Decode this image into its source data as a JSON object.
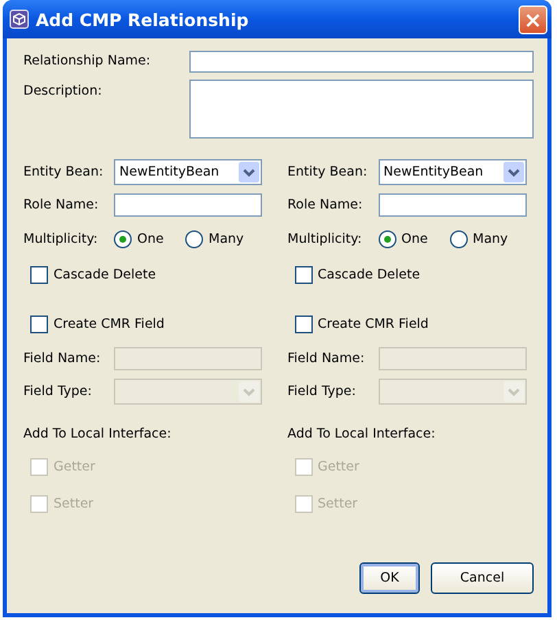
{
  "window": {
    "title": "Add CMP Relationship",
    "close": "×"
  },
  "relationship_name": {
    "label": "Relationship Name:"
  },
  "description": {
    "label": "Description:"
  },
  "roles": [
    {
      "entity_bean": {
        "label": "Entity Bean:",
        "value": "NewEntityBean"
      },
      "role_name": {
        "label": "Role Name:"
      },
      "multiplicity": {
        "label": "Multiplicity:",
        "options": [
          {
            "label": "One",
            "selected": true
          },
          {
            "label": "Many",
            "selected": false
          }
        ]
      },
      "cascade_delete": {
        "label": "Cascade Delete",
        "checked": false
      },
      "create_cmr_field": {
        "label": "Create CMR Field",
        "checked": false
      },
      "field_name": {
        "label": "Field Name:",
        "disabled": true
      },
      "field_type": {
        "label": "Field Type:",
        "disabled": true
      },
      "local_interface": {
        "label": "Add To Local Interface:",
        "options": [
          {
            "label": "Getter",
            "checked": false,
            "disabled": true
          },
          {
            "label": "Setter",
            "checked": false,
            "disabled": true
          }
        ]
      }
    },
    {
      "entity_bean": {
        "label": "Entity Bean:",
        "value": "NewEntityBean"
      },
      "role_name": {
        "label": "Role Name:"
      },
      "multiplicity": {
        "label": "Multiplicity:",
        "options": [
          {
            "label": "One",
            "selected": true
          },
          {
            "label": "Many",
            "selected": false
          }
        ]
      },
      "cascade_delete": {
        "label": "Cascade Delete",
        "checked": false
      },
      "create_cmr_field": {
        "label": "Create CMR Field",
        "checked": false
      },
      "field_name": {
        "label": "Field Name:",
        "disabled": true
      },
      "field_type": {
        "label": "Field Type:",
        "disabled": true
      },
      "local_interface": {
        "label": "Add To Local Interface:",
        "options": [
          {
            "label": "Getter",
            "checked": false,
            "disabled": true
          },
          {
            "label": "Setter",
            "checked": false,
            "disabled": true
          }
        ]
      }
    }
  ],
  "buttons": [
    {
      "label": "OK",
      "default": true
    },
    {
      "label": "Cancel",
      "default": false
    }
  ]
}
